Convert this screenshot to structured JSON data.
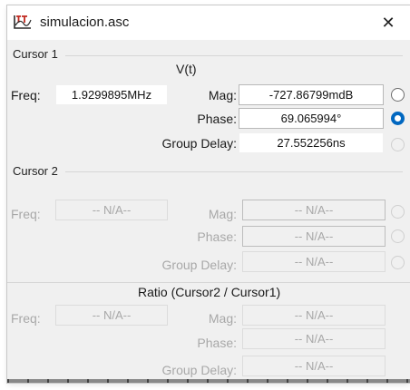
{
  "window": {
    "title": "simulacion.asc",
    "close_glyph": "✕",
    "icon": "ltspice-app-icon"
  },
  "cursor1": {
    "section_label": "Cursor 1",
    "signal": "V(t)",
    "freq_label": "Freq:",
    "freq_value": "1.9299895MHz",
    "mag_label": "Mag:",
    "mag_value": "-727.86799mdB",
    "phase_label": "Phase:",
    "phase_value": "69.065994°",
    "group_delay_label": "Group Delay:",
    "group_delay_value": "27.552256ns",
    "selected_radio": "phase"
  },
  "cursor2": {
    "section_label": "Cursor 2",
    "freq_label": "Freq:",
    "freq_value": "-- N/A--",
    "mag_label": "Mag:",
    "mag_value": "-- N/A--",
    "phase_label": "Phase:",
    "phase_value": "-- N/A--",
    "group_delay_label": "Group Delay:",
    "group_delay_value": "-- N/A--"
  },
  "ratio": {
    "section_label": "Ratio (Cursor2 / Cursor1)",
    "freq_label": "Freq:",
    "freq_value": "-- N/A--",
    "mag_label": "Mag:",
    "mag_value": "-- N/A--",
    "phase_label": "Phase:",
    "phase_value": "-- N/A--",
    "group_delay_label": "Group Delay:",
    "group_delay_value": "-- N/A--"
  },
  "colors": {
    "accent": "#0067c0",
    "disabled_text": "#a8a8a8",
    "window_bg": "#f0f0f0",
    "icon_red": "#c0281e"
  }
}
